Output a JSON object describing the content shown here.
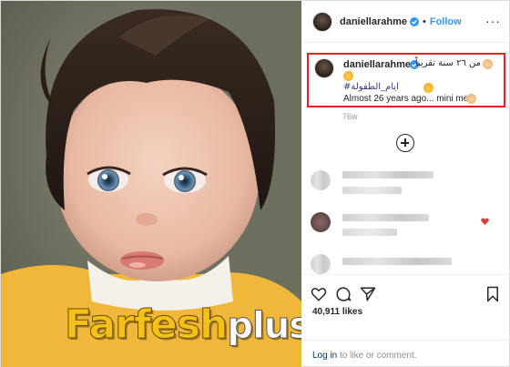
{
  "header": {
    "username": "daniellarahme",
    "separator": "•",
    "follow_label": "Follow",
    "more_label": "···",
    "verified_icon": "verified-badge-icon"
  },
  "caption": {
    "username": "daniellarahme",
    "arabic_line1": "من ٢٦ سنة تقريباً",
    "arabic_hashtag": "#ايام_الطفولة",
    "english_line": "Almost 26 years ago... mini me",
    "emojis": [
      "baby-face-emoji",
      "woman-emoji",
      "smiling-face-emoji",
      "baby-face-emoji"
    ]
  },
  "post_age": "76w",
  "comments": [
    {
      "blurred": true,
      "liked": false
    },
    {
      "blurred": true,
      "liked": true
    },
    {
      "blurred": true,
      "liked": false
    }
  ],
  "actions": {
    "like_icon": "heart-icon",
    "comment_icon": "comment-icon",
    "share_icon": "share-icon",
    "save_icon": "bookmark-icon"
  },
  "likes_count": "40,911 likes",
  "login_prompt": {
    "link_text": "Log in",
    "rest_text": " to like or comment."
  },
  "watermark": {
    "part1": "Farfesh",
    "part2": "plus.com"
  },
  "colors": {
    "accent": "#3897f0",
    "highlight_box": "#e52222",
    "hashtag": "#3a3a8a"
  }
}
